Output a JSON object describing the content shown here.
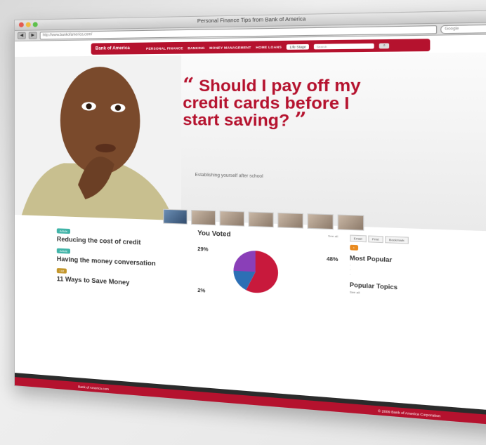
{
  "browser": {
    "window_title": "Personal Finance Tips from Bank of America",
    "url": "http://www.bankofamerica.com/",
    "search_placeholder": "Google"
  },
  "site": {
    "logo": "Bank of America",
    "nav": [
      "PERSONAL FINANCE",
      "BANKING",
      "MONEY MANAGEMENT",
      "HOME LOANS"
    ],
    "dropdown": "Life Stage",
    "search_placeholder": "Search"
  },
  "hero": {
    "open_quote": "“",
    "quote": "Should I pay off my credit cards before I start saving?",
    "close_quote": "”",
    "subline": "Establishing yourself after school"
  },
  "articles": [
    {
      "badge": "Article",
      "title": "Reducing the cost of credit",
      "text": ""
    },
    {
      "badge": "Article",
      "title": "Having the money conversation",
      "text": ""
    },
    {
      "badge": "List",
      "title": "11 Ways to Save Money",
      "text": ""
    }
  ],
  "poll": {
    "title": "You Voted",
    "link": "See all",
    "pct_left_top": "29%",
    "pct_right": "48%",
    "pct_left_bottom": "2%"
  },
  "sidebar": {
    "tabs": [
      "Email",
      "Print",
      "Bookmark"
    ],
    "most_popular_title": "Most Popular",
    "popular_topics_title": "Popular Topics",
    "see_all": "See all"
  },
  "footer": {
    "left": "Bank of America.com",
    "right": "© 2009 Bank of America Corporation"
  },
  "colors": {
    "brand": "#b5122e",
    "teal": "#41b4a8",
    "gold": "#c3962b",
    "orange": "#e98a1f"
  }
}
